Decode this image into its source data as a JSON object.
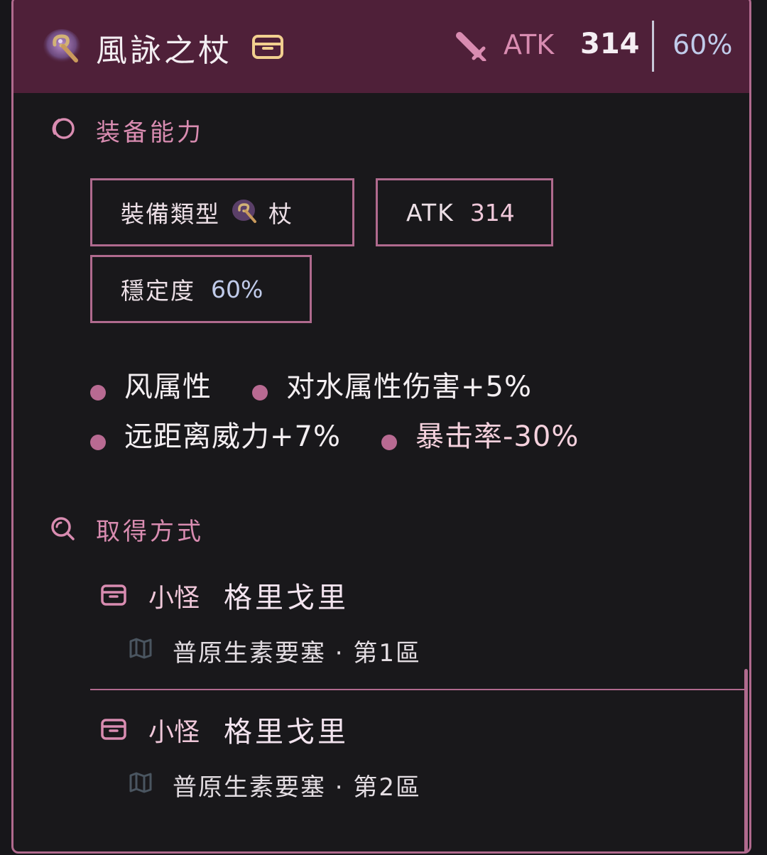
{
  "header": {
    "title": "風詠之杖",
    "atk_label": "ATK",
    "atk_value": "314",
    "stability_value": "60%"
  },
  "abilities": {
    "heading": "装备能力",
    "weapon_type_label": "裝備類型",
    "weapon_type_value": "杖",
    "atk_label": "ATK",
    "atk_value": "314",
    "stability_label": "穩定度",
    "stability_value": "60%"
  },
  "traits": [
    {
      "text": "风属性"
    },
    {
      "text": "对水属性伤害+5%"
    },
    {
      "text": "远距离威力+7%"
    },
    {
      "text": "暴击率-30%"
    }
  ],
  "acquisition": {
    "heading": "取得方式",
    "sources": [
      {
        "type": "小怪",
        "name": "格里戈里",
        "location": "普原生素要塞 · 第1區"
      },
      {
        "type": "小怪",
        "name": "格里戈里",
        "location": "普原生素要塞 · 第2區"
      }
    ]
  },
  "icons": {
    "weapon": "staff-icon",
    "chest": "chest-icon",
    "sword": "sword-icon",
    "abilities": "swirl-icon",
    "acquisition": "search-icon",
    "source": "chest-icon",
    "location": "map-icon"
  },
  "colors": {
    "accent": "#b06a8e",
    "header_bg": "#4f2039",
    "background": "#19181b",
    "pink_text": "#d98cb1",
    "blue_text": "#c0cbea"
  }
}
